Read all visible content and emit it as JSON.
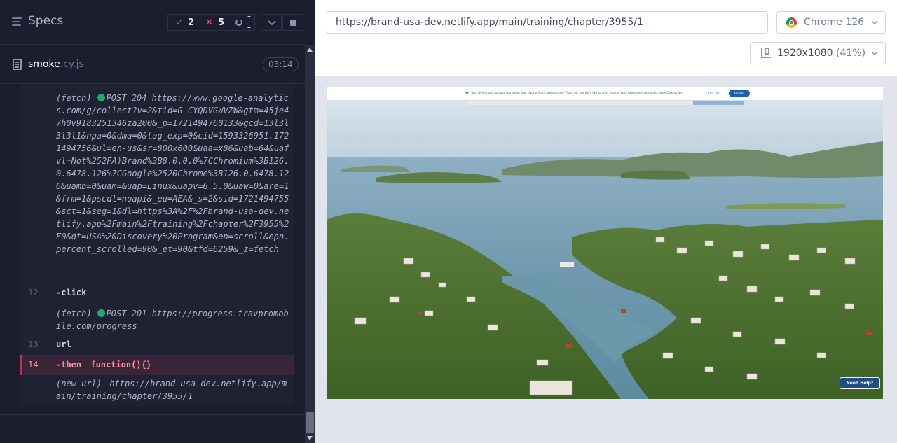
{
  "specs_header": {
    "title": "Specs",
    "passed": "2",
    "failed": "5",
    "pending": "--"
  },
  "spec": {
    "name": "smoke",
    "ext": ".cy.js",
    "duration": "03:14"
  },
  "log": [
    {
      "num": "",
      "prefix": "(fetch)",
      "method": "POST 204",
      "text": "https://www.google-analytics.com/g/collect?v=2&tid=G-CYQDVGWVZW&gtm=45je47h0v9183251346za200&_p=1721494760133&gcd=13l3l3l3l1&npa=0&dma=0&tag_exp=0&cid=1593326951.1721494756&ul=en-us&sr=800x600&uaa=x86&uab=64&uafvl=Not%252FA)Brand%3B8.0.0.0%7CChromium%3B126.0.6478.126%7CGoogle%2520Chrome%3B126.0.6478.126&uamb=0&uam=&uap=Linux&uapv=6.5.0&uaw=0&are=1&frm=1&pscdl=noapi&_eu=AEA&_s=2&sid=1721494755&sct=1&seg=1&dl=https%3A%2F%2Fbrand-usa-dev.netlify.app%2Fmain%2Ftraining%2Fchapter%2F3955%2F0&dt=USA%20Discovery%20Program&en=scroll&epn.percent_scrolled=90&_et=90&tfd=6259&_z=fetch"
    },
    {
      "num": "12",
      "cmd": "-click"
    },
    {
      "num": "",
      "prefix": "(fetch)",
      "method": "POST 201",
      "text": "https://progress.travpromobile.com/progress"
    },
    {
      "num": "13",
      "cmd": "url"
    },
    {
      "num": "14",
      "cmd": "-then",
      "arg": "function(){}"
    },
    {
      "num": "",
      "prefix": "(new url)",
      "text": "https://brand-usa-dev.netlify.app/main/training/chapter/3955/1"
    }
  ],
  "browser": {
    "url": "https://brand-usa-dev.netlify.app/main/training/chapter/3955/1",
    "name": "Chrome 126",
    "viewport": "1920x1080",
    "zoom": "(41%)"
  },
  "aut": {
    "cookie_text": "You haven't told us anything about your data privacy preferences! That's ok, but we'd like to offer you the best experience using the Sales Companion.",
    "opt_out": "OPT OUT",
    "accept": "ACCEPT",
    "help": "Need Help?"
  },
  "colors": {
    "pass": "#1fa971",
    "fail": "#f24e72",
    "accent": "#1a62b0"
  }
}
